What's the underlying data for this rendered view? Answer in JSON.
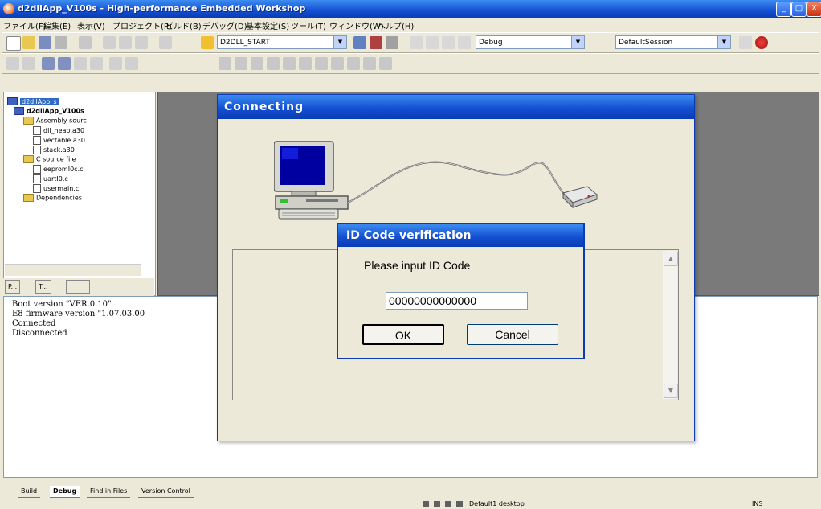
{
  "window": {
    "title": "d2dllApp_V100s - High-performance Embedded Workshop",
    "controls": {
      "minimize": "_",
      "maximize": "□",
      "close": "X"
    }
  },
  "menu": [
    "ファイル(F)",
    "編集(E)",
    "表示(V)",
    "プロジェクト(P)",
    "ビルド(B)",
    "デバッグ(D)",
    "基本設定(S)",
    "ツール(T)",
    "ウィンドウ(W)",
    "ヘルプ(H)"
  ],
  "toolbar": {
    "project_combo": "D2DLL_START",
    "config_combo": "Debug",
    "session_combo": "DefaultSession"
  },
  "tree": {
    "items": [
      {
        "label": "d2dllApp_s",
        "type": "root"
      },
      {
        "label": "d2dllApp_V100s",
        "type": "project"
      },
      {
        "label": "Assembly sourc",
        "type": "folder"
      },
      {
        "label": "dll_heap.a30",
        "type": "file"
      },
      {
        "label": "vectable.a30",
        "type": "file"
      },
      {
        "label": "stack.a30",
        "type": "file"
      },
      {
        "label": "C source file",
        "type": "folder"
      },
      {
        "label": "eepromI0c.c",
        "type": "file"
      },
      {
        "label": "uartI0.c",
        "type": "file"
      },
      {
        "label": "usermain.c",
        "type": "file"
      },
      {
        "label": "Dependencies",
        "type": "folder"
      }
    ],
    "tabs": [
      "P...",
      "T..."
    ]
  },
  "output": {
    "lines": [
      "Boot version \"VER.0.10\"",
      "E8 firmware version \"1.07.03.00",
      "Connected",
      "Disconnected"
    ],
    "tabs": [
      "Build",
      "Debug",
      "Find in Files",
      "Version Control"
    ],
    "active_tab": "Debug"
  },
  "status": {
    "desktop": "Default1 desktop",
    "mode": "INS"
  },
  "connecting_dialog": {
    "title": "Connecting"
  },
  "id_dialog": {
    "title": "ID Code verification",
    "prompt": "Please input ID Code",
    "input_value": "00000000000000",
    "ok_label": "OK",
    "cancel_label": "Cancel"
  },
  "colors": {
    "title_blue": "#1450d2",
    "dialog_face": "#ece9d8",
    "editor_gray": "#7a7a7a"
  }
}
